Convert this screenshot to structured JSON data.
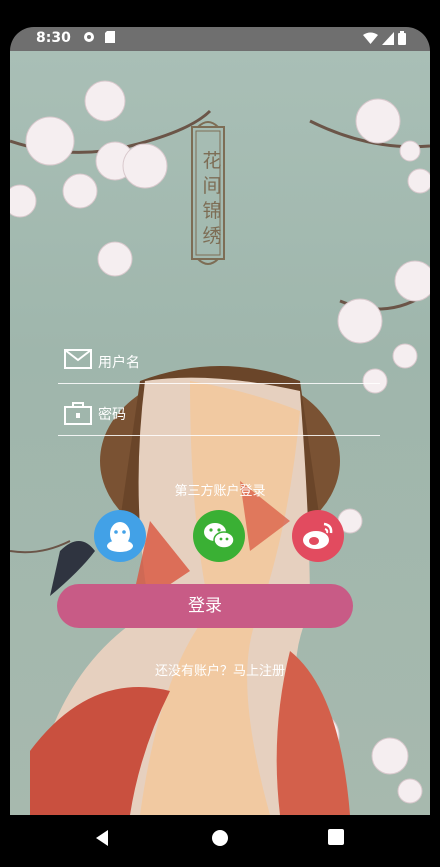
{
  "status_bar": {
    "time": "8:30"
  },
  "app": {
    "title_chars": [
      "花",
      "间",
      "锦",
      "绣"
    ]
  },
  "login_form": {
    "username_placeholder": "用户名",
    "password_placeholder": "密码"
  },
  "third_party": {
    "title": "第三方账户登录",
    "providers": [
      {
        "name": "QQ",
        "icon": "qq-icon",
        "color": "#42a1e7"
      },
      {
        "name": "WeChat",
        "icon": "wechat-icon",
        "color": "#3ab034"
      },
      {
        "name": "Weibo",
        "icon": "weibo-icon",
        "color": "#e24b5f"
      }
    ]
  },
  "actions": {
    "login_label": "登录",
    "register_link": "还没有账户？马上注册"
  },
  "colors": {
    "login_button": "#c85b86",
    "background": "#a9bfb6"
  }
}
